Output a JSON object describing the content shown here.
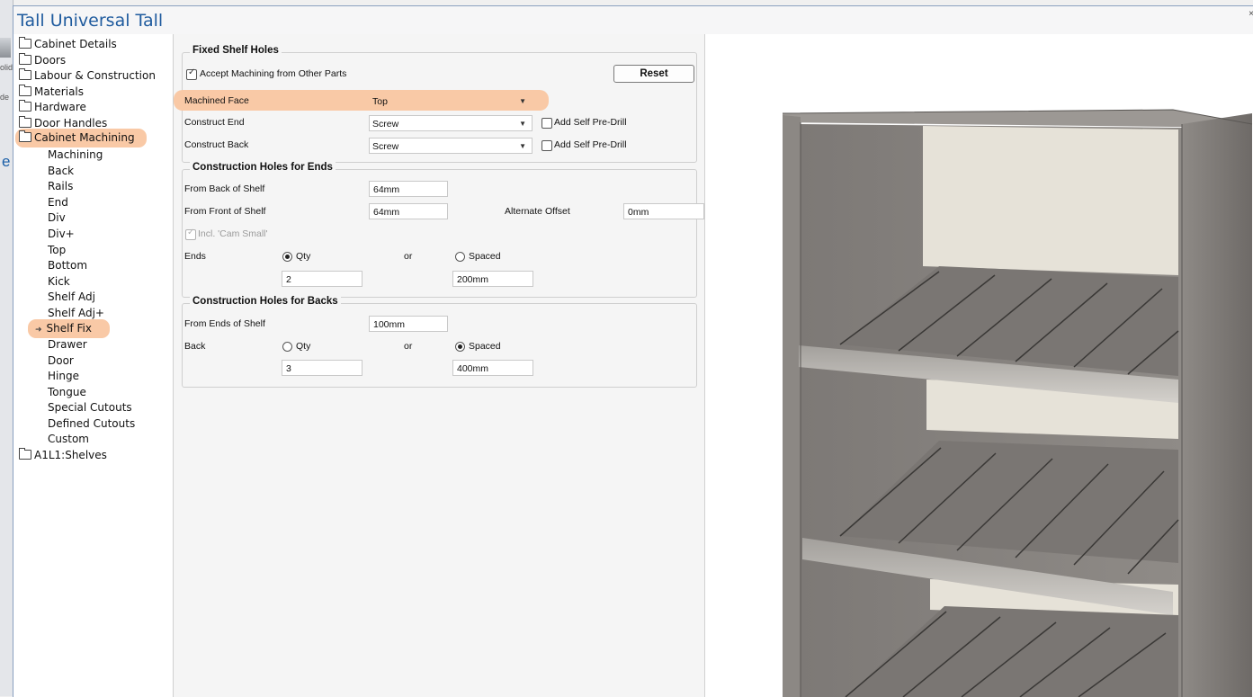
{
  "window": {
    "title": "Tall Universal Tall"
  },
  "tree": {
    "folders_top": [
      "Cabinet Details",
      "Doors",
      "Labour & Construction",
      "Materials",
      "Hardware",
      "Door Handles",
      "Cabinet Machining"
    ],
    "children": [
      "Machining",
      "Back",
      "Rails",
      "End",
      "Div",
      "Div+",
      "Top",
      "Bottom",
      "Kick",
      "Shelf Adj",
      "Shelf Adj+",
      "Shelf Fix",
      "Drawer",
      "Door",
      "Hinge",
      "Tongue",
      "Special Cutouts",
      "Defined Cutouts",
      "Custom"
    ],
    "folders_bottom": [
      "A1L1:Shelves"
    ],
    "selected": "Shelf Fix"
  },
  "fixed_shelf_holes": {
    "title": "Fixed Shelf Holes",
    "accept_label": "Accept Machining from Other Parts",
    "accept_checked": true,
    "reset_label": "Reset",
    "machined_face_label": "Machined Face",
    "machined_face_value": "Top",
    "construct_end_label": "Construct End",
    "construct_end_value": "Screw",
    "construct_back_label": "Construct Back",
    "construct_back_value": "Screw",
    "add_self_predrill_label": "Add Self Pre-Drill"
  },
  "holes_ends": {
    "title": "Construction Holes for Ends",
    "from_back_label": "From Back of Shelf",
    "from_back_value": "64mm",
    "from_front_label": "From Front of Shelf",
    "from_front_value": "64mm",
    "alternate_offset_label": "Alternate Offset",
    "alternate_offset_value": "0mm",
    "incl_cam_label": "Incl. 'Cam Small'",
    "ends_label": "Ends",
    "qty_label": "Qty",
    "or_label": "or",
    "spaced_label": "Spaced",
    "qty_value": "2",
    "spaced_value": "200mm",
    "mode": "Qty"
  },
  "holes_backs": {
    "title": "Construction Holes for Backs",
    "from_ends_label": "From Ends of Shelf",
    "from_ends_value": "100mm",
    "back_label": "Back",
    "qty_label": "Qty",
    "or_label": "or",
    "spaced_label": "Spaced",
    "qty_value": "3",
    "spaced_value": "400mm",
    "mode": "Spaced"
  },
  "behind": {
    "labels": [
      "olid",
      "de",
      "e"
    ]
  },
  "colors": {
    "highlight": "#f9c9a6",
    "title_blue": "#1f5b9e"
  }
}
